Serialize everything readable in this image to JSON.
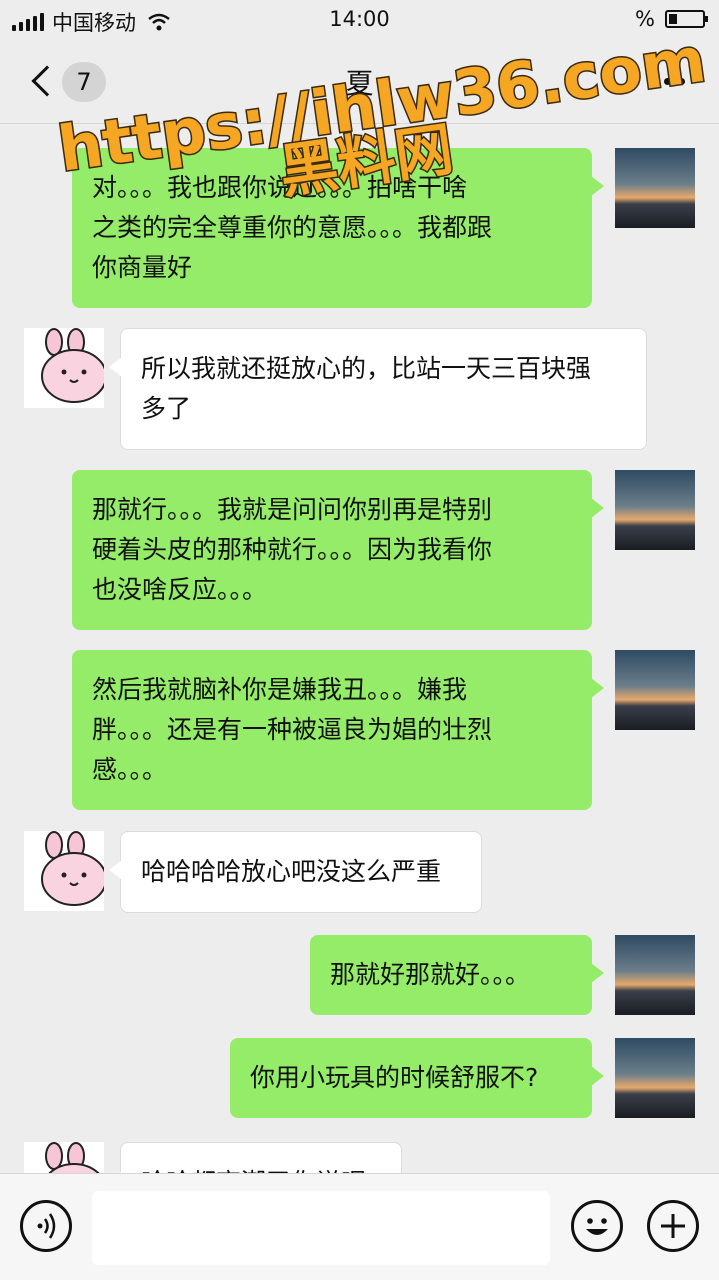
{
  "status_bar": {
    "carrier": "中国移动",
    "time": "14:00",
    "battery_text": "%",
    "battery_level": 0.25
  },
  "title_bar": {
    "unread_count": "7",
    "title": "夏",
    "icons": [
      "chevron-left-icon",
      "more-icon"
    ]
  },
  "watermark": {
    "url": "https://ihlw36.com",
    "name": "黑料网"
  },
  "messages": [
    {
      "side": "me",
      "text": "对。。。我也跟你说过。。。拍啥干啥\n之类的完全尊重你的意愿。。。我都跟\n你商量好"
    },
    {
      "side": "them",
      "text": "所以我就还挺放心的，比站一天三百块强\n多了"
    },
    {
      "side": "me",
      "text": "那就行。。。我就是问问你别再是特别\n硬着头皮的那种就行。。。因为我看你\n也没啥反应。。。"
    },
    {
      "side": "me",
      "text": "然后我就脑补你是嫌我丑。。。嫌我\n胖。。。还是有一种被逼良为娼的壮烈\n感。。。"
    },
    {
      "side": "them",
      "text": "哈哈哈哈放心吧没这么严重"
    },
    {
      "side": "me",
      "text": "那就好那就好。。。"
    },
    {
      "side": "me",
      "text": "你用小玩具的时候舒服不?"
    },
    {
      "side": "them",
      "text": "哈哈都高潮了你说呢"
    }
  ],
  "input_bar": {
    "placeholder": "",
    "icons": [
      "voice-icon",
      "emoji-icon",
      "plus-icon"
    ]
  },
  "colors": {
    "background": "#ededed",
    "my_bubble": "#95ec69",
    "their_bubble": "#ffffff",
    "watermark_fill": "#f5a623",
    "watermark_stroke": "#3a2a10"
  }
}
